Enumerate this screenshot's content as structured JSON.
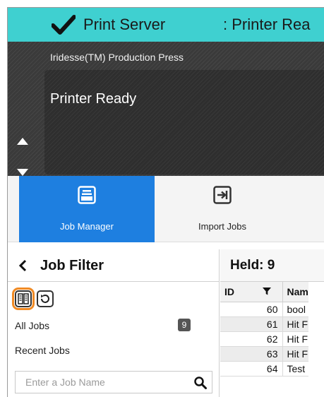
{
  "status_bar": {
    "app_name": "Print Server",
    "status_text": ": Printer Rea",
    "status_icon": "checkmark-icon"
  },
  "printer": {
    "name": "Iridesse(TM) Production Press",
    "state": "Printer Ready"
  },
  "toolbar": {
    "items": [
      {
        "label": "Job Manager",
        "icon": "job-manager-icon",
        "active": true
      },
      {
        "label": "Import Jobs",
        "icon": "import-icon",
        "active": false
      }
    ]
  },
  "job_filter": {
    "title": "Job Filter",
    "filters": [
      {
        "label": "All Jobs",
        "count": "9"
      },
      {
        "label": "Recent Jobs"
      }
    ],
    "search": {
      "placeholder": "Enter a Job Name",
      "value": ""
    }
  },
  "job_list": {
    "title": "Held: 9",
    "columns": [
      "ID",
      "Nam"
    ],
    "rows": [
      {
        "id": "60",
        "name": "bool"
      },
      {
        "id": "61",
        "name": "Hit F"
      },
      {
        "id": "62",
        "name": "Hit F"
      },
      {
        "id": "63",
        "name": "Hit F"
      },
      {
        "id": "64",
        "name": "Test"
      }
    ]
  },
  "colors": {
    "status_bar": "#3fd0d0",
    "active_tab": "#1e7fe0",
    "highlight": "#f08a24"
  }
}
